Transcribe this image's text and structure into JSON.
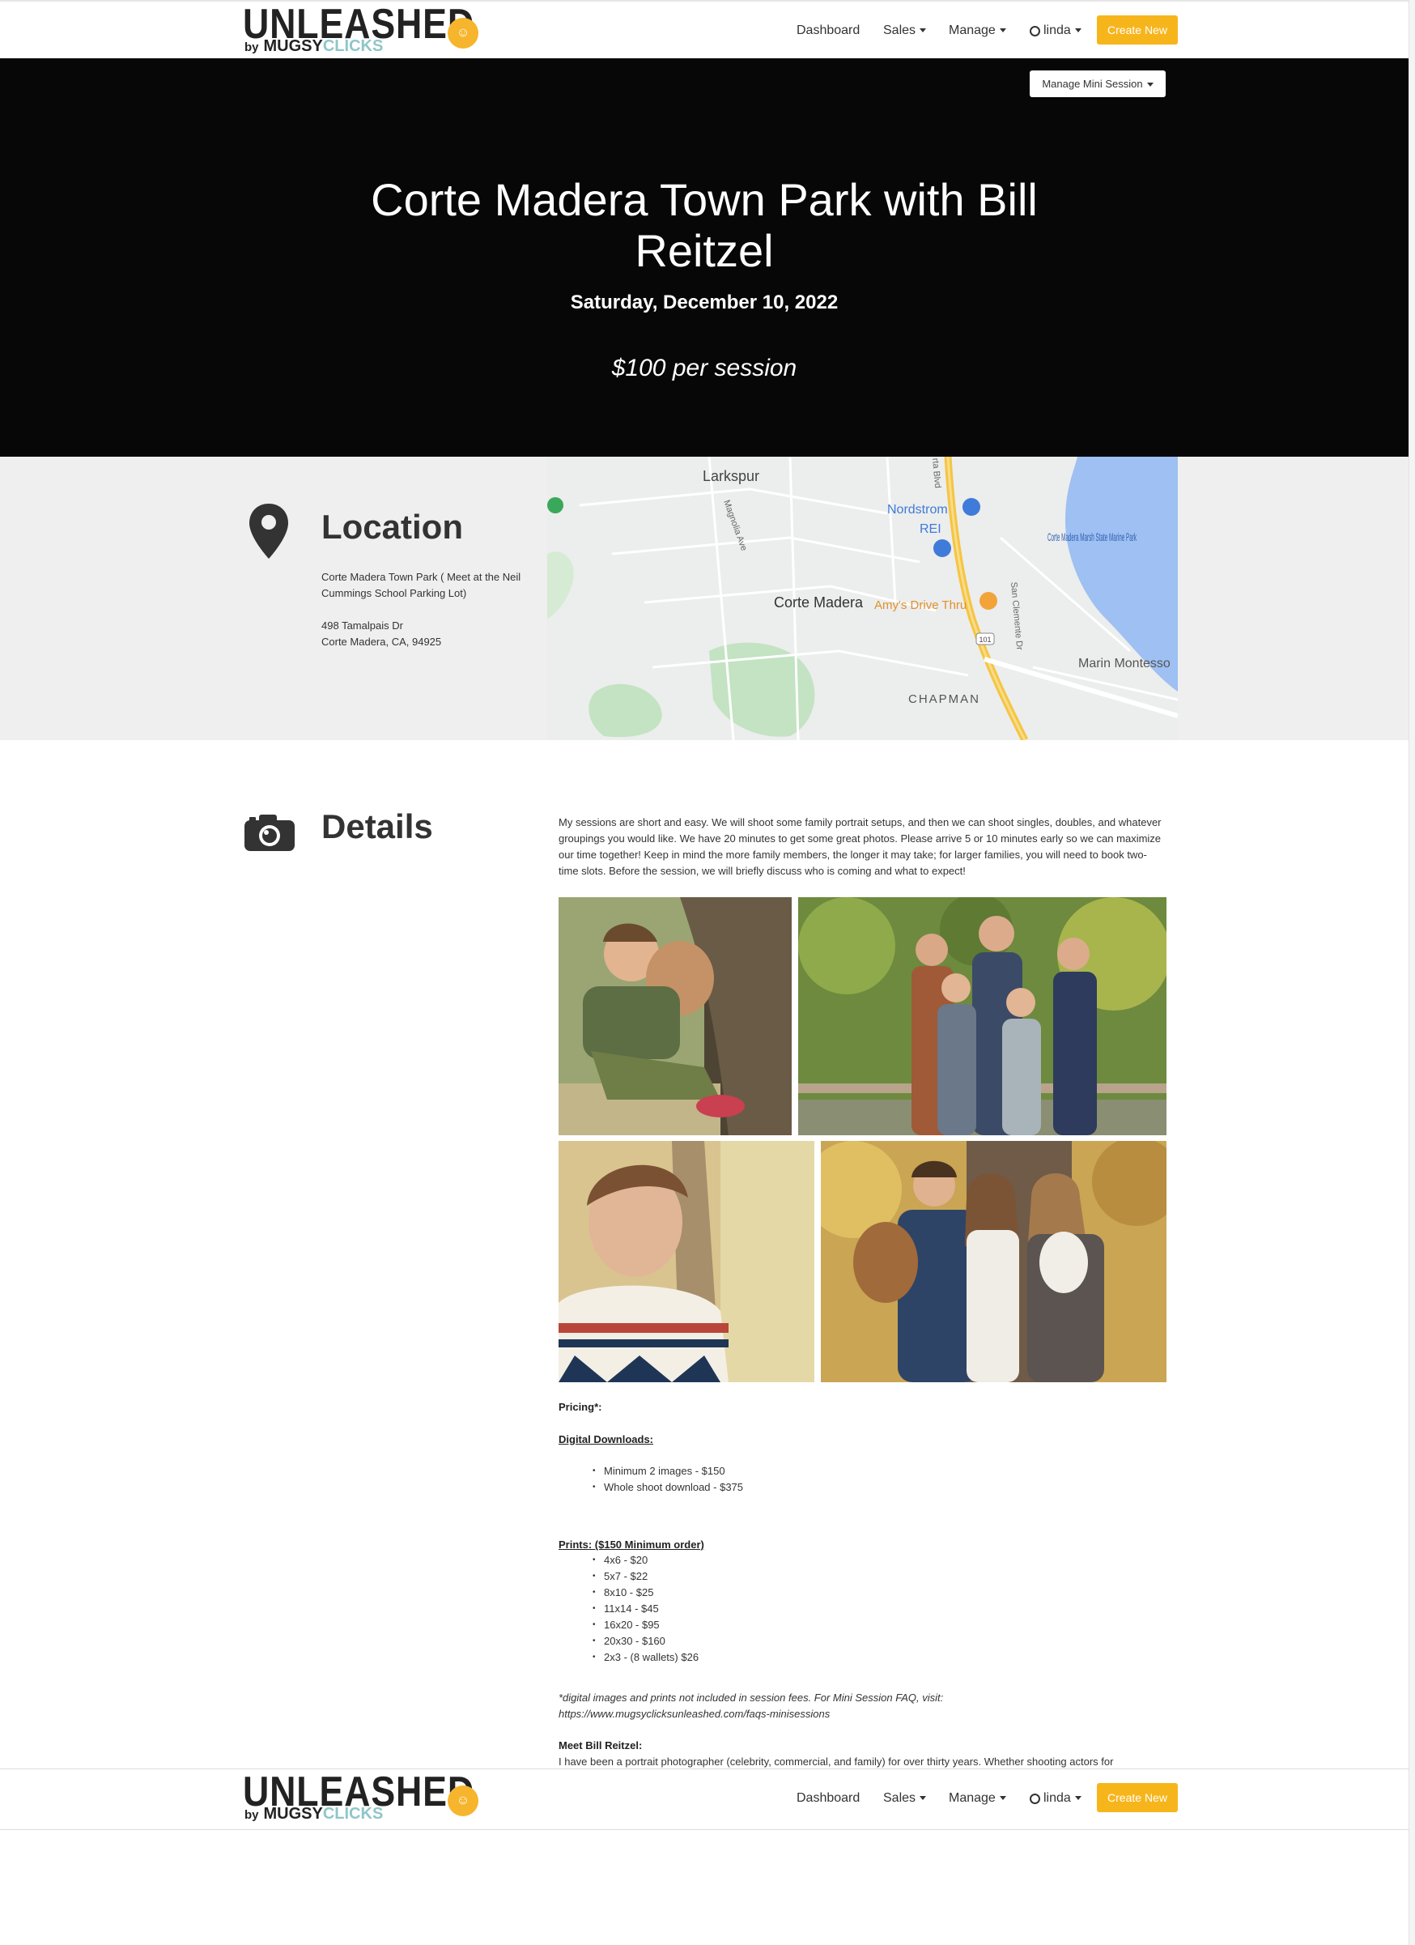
{
  "nav": {
    "logo_word": "UNLEASHED",
    "logo_by": "by",
    "logo_brand1": "MUGSY",
    "logo_brand2": "CLICKS",
    "links": [
      "Dashboard",
      "Sales",
      "Manage"
    ],
    "user": "linda",
    "create_label": "Create New"
  },
  "hero": {
    "manage_label": "Manage Mini Session",
    "title": "Corte Madera Town Park with Bill Reitzel",
    "date": "Saturday, December 10, 2022",
    "price": "$100 per session"
  },
  "location": {
    "heading": "Location",
    "place": "Corte Madera Town Park ( Meet at the Neil Cummings School Parking Lot)",
    "street": "498 Tamalpais Dr",
    "city": "Corte Madera, CA, 94925",
    "map_labels": {
      "larkspur": "Larkspur",
      "nordstrom": "Nordstrom",
      "rei": "REI",
      "corte_madera": "Corte Madera",
      "amys": "Amy's Drive Thru",
      "marsh": "Corte Madera Marsh State Marine Park",
      "marin": "Marin Montesso",
      "chapman": "CHAPMAN",
      "highway": "101",
      "magnolia": "Magnolia Ave",
      "san_clemente": "San Clemente Dr",
      "vista": "rta Blvd"
    }
  },
  "details": {
    "heading": "Details",
    "paragraph": "My sessions are short and easy. We will shoot some family portrait setups, and then we can shoot singles, doubles, and whatever groupings you would like. We have 20 minutes to get some great photos. Please arrive 5 or 10 minutes early so we can maximize our time together! Keep in mind the more family members, the longer it may take; for larger families, you will need to book two-time slots. Before the session, we will briefly discuss who is coming and what to expect!",
    "pricing_label": "Pricing*:",
    "digital_label": "Digital Downloads:",
    "digital_items": [
      "Minimum 2 images - $150",
      "Whole shoot download - $375"
    ],
    "prints_label": "Prints: ($150 Minimum order)",
    "prints_items": [
      "4x6 - $20",
      "5x7 - $22",
      "8x10 - $25",
      "11x14 - $45",
      "16x20 - $95",
      "20x30 - $160",
      "2x3 - (8 wallets) $26"
    ],
    "note": "*digital images and prints not included in session fees. For Mini Session FAQ, visit: https://www.mugsyclicksunleashed.com/faqs-minisessions",
    "meet_label": "Meet Bill Reitzel:",
    "meet_text": "I have been a portrait photographer (celebrity, commercial, and family) for over thirty years. Whether shooting actors for"
  },
  "colors": {
    "accent": "#f7b51c",
    "hero_bg": "#070707",
    "location_bg": "#efefef",
    "logo_teal": "#8fc6c8"
  }
}
